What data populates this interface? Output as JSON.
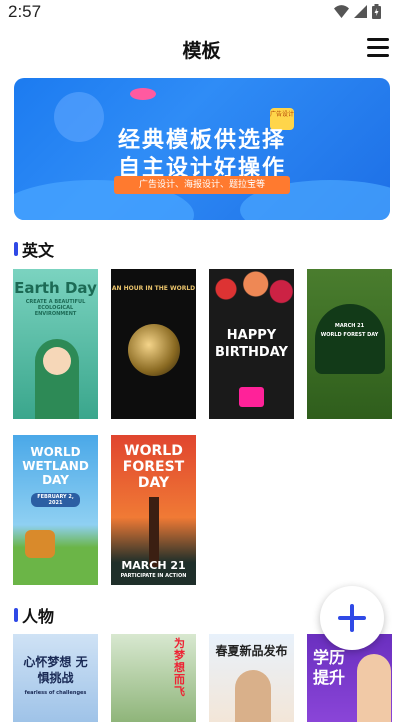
{
  "status": {
    "time": "2:57"
  },
  "header": {
    "title": "模板"
  },
  "banner": {
    "line1": "经典模板供选择",
    "line2": "自主设计好操作",
    "tag": "广告设计、海报设计、题拉宝等",
    "badge": "广告设计"
  },
  "sections": [
    {
      "title": "英文"
    },
    {
      "title": "人物"
    }
  ],
  "english_cards": [
    {
      "title": "Earth Day",
      "sub": "CREATE A BEAUTIFUL ECOLOGICAL ENVIRONMENT"
    },
    {
      "title": "AN HOUR IN THE WORLD"
    },
    {
      "title": "HAPPY BIRTHDAY"
    },
    {
      "title": "WORLD FOREST DAY",
      "sub": "MARCH 21"
    },
    {
      "title": "WORLD WETLAND DAY",
      "sub": "FEBRUARY 2, 2021"
    },
    {
      "title": "WORLD FOREST DAY",
      "sub": "MARCH 21",
      "sub2": "PARTICIPATE IN ACTION"
    }
  ],
  "people_cards": [
    {
      "title": "心怀梦想 无惧挑战",
      "sub": "fearless of challenges"
    },
    {
      "title": "为梦想而飞"
    },
    {
      "title": "春夏新品发布"
    },
    {
      "title": "学历提升"
    }
  ],
  "fab": {
    "icon": "plus-icon"
  }
}
